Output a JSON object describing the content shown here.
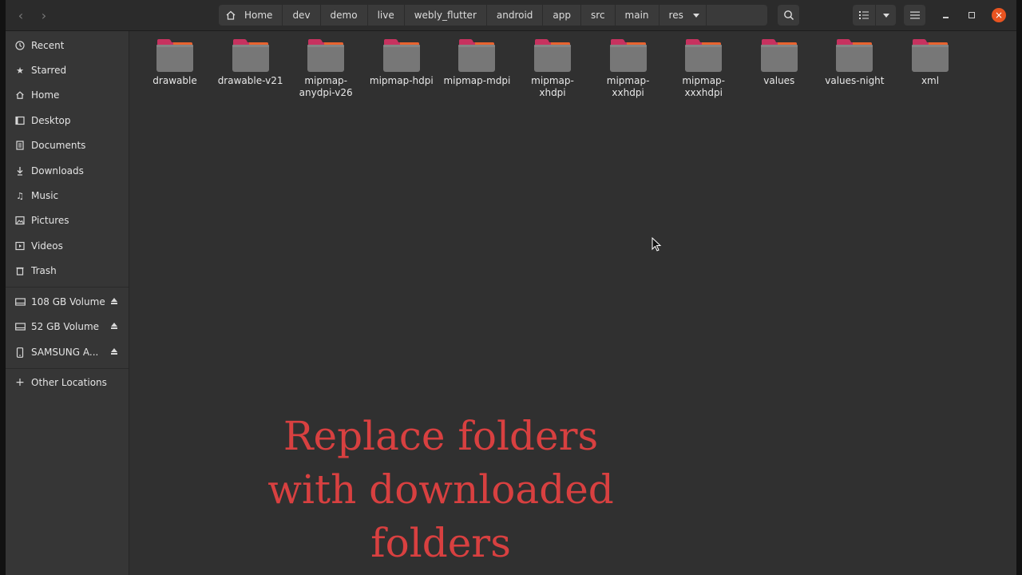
{
  "header": {
    "path": [
      "Home",
      "dev",
      "demo",
      "live",
      "webly_flutter",
      "android",
      "app",
      "src",
      "main",
      "res"
    ],
    "icons": {
      "back": "chevron-left-icon",
      "forward": "chevron-right-icon",
      "home": "home-icon",
      "search": "search-icon",
      "view_list": "list-view-icon",
      "view_options": "caret-down-icon",
      "menu": "hamburger-menu-icon",
      "minimize": "minimize-icon",
      "maximize": "maximize-icon",
      "close": "close-icon"
    },
    "close_color": "#e95420"
  },
  "sidebar": {
    "places": [
      {
        "label": "Recent",
        "icon": "clock-icon"
      },
      {
        "label": "Starred",
        "icon": "star-icon"
      },
      {
        "label": "Home",
        "icon": "home-icon"
      },
      {
        "label": "Desktop",
        "icon": "desktop-icon"
      },
      {
        "label": "Documents",
        "icon": "document-icon"
      },
      {
        "label": "Downloads",
        "icon": "download-icon"
      },
      {
        "label": "Music",
        "icon": "music-note-icon"
      },
      {
        "label": "Pictures",
        "icon": "picture-icon"
      },
      {
        "label": "Videos",
        "icon": "video-icon"
      },
      {
        "label": "Trash",
        "icon": "trash-icon"
      }
    ],
    "devices": [
      {
        "label": "108 GB Volume",
        "icon": "drive-icon"
      },
      {
        "label": "52 GB Volume",
        "icon": "drive-icon"
      },
      {
        "label": "SAMSUNG A...",
        "icon": "phone-icon"
      }
    ],
    "other": {
      "label": "Other Locations",
      "icon": "plus-icon"
    }
  },
  "folders": [
    {
      "name": "drawable"
    },
    {
      "name": "drawable-v21"
    },
    {
      "name": "mipmap-\nanydpi-v26"
    },
    {
      "name": "mipmap-hdpi"
    },
    {
      "name": "mipmap-mdpi"
    },
    {
      "name": "mipmap-\nxhdpi"
    },
    {
      "name": "mipmap-\nxxhdpi"
    },
    {
      "name": "mipmap-\nxxxhdpi"
    },
    {
      "name": "values"
    },
    {
      "name": "values-night"
    },
    {
      "name": "xml"
    }
  ],
  "overlay_text": "Replace folders with downloaded folders",
  "colors": {
    "folder_tab": "#c7325f",
    "folder_accent": "#e8632f",
    "overlay": "#d84040"
  }
}
